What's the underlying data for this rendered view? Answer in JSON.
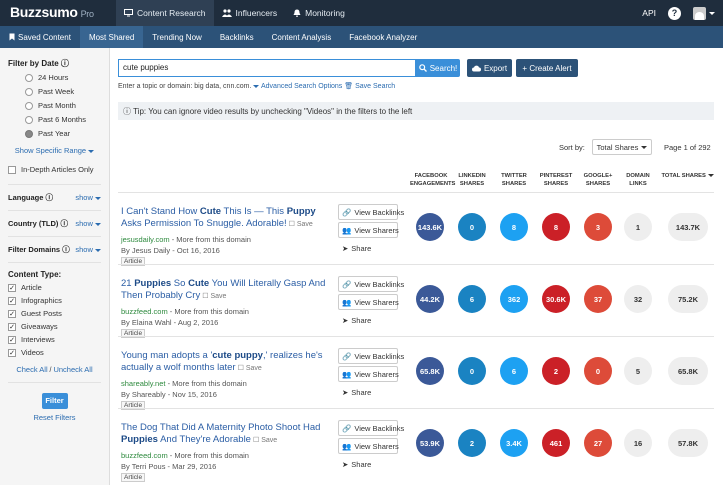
{
  "app": {
    "logo": "Buzzsumo",
    "logo_suffix": "Pro"
  },
  "topnav": {
    "items": [
      {
        "label": "Content Research",
        "icon": "monitor-icon",
        "active": true
      },
      {
        "label": "Influencers",
        "icon": "people-icon",
        "active": false
      },
      {
        "label": "Monitoring",
        "icon": "bell-icon",
        "active": false
      }
    ],
    "api_label": "API",
    "help_label": "?"
  },
  "subnav": {
    "items": [
      {
        "label": "Saved Content",
        "icon": "bookmark-icon",
        "active": false
      },
      {
        "label": "Most Shared",
        "active": true
      },
      {
        "label": "Trending Now",
        "active": false
      },
      {
        "label": "Backlinks",
        "active": false
      },
      {
        "label": "Content Analysis",
        "active": false
      },
      {
        "label": "Facebook Analyzer",
        "active": false
      }
    ]
  },
  "sidebar": {
    "filter_by_date": "Filter by Date",
    "dates": [
      {
        "label": "24 Hours",
        "selected": false
      },
      {
        "label": "Past Week",
        "selected": false
      },
      {
        "label": "Past Month",
        "selected": false
      },
      {
        "label": "Past 6 Months",
        "selected": false
      },
      {
        "label": "Past Year",
        "selected": true
      }
    ],
    "show_specific_range": "Show Specific Range",
    "in_depth_only": "In-Depth Articles Only",
    "language": "Language",
    "country": "Country (TLD)",
    "filter_domains": "Filter Domains",
    "show_label": "show",
    "content_type": "Content Type:",
    "types": [
      {
        "label": "Article",
        "checked": true
      },
      {
        "label": "Infographics",
        "checked": true
      },
      {
        "label": "Guest Posts",
        "checked": true
      },
      {
        "label": "Giveaways",
        "checked": true
      },
      {
        "label": "Interviews",
        "checked": true
      },
      {
        "label": "Videos",
        "checked": true
      }
    ],
    "check_all": "Check All",
    "separator": " / ",
    "uncheck_all": "Uncheck All",
    "filter_button": "Filter",
    "reset_filters": "Reset Filters"
  },
  "search": {
    "value": "cute puppies",
    "button_label": "Search!",
    "hint_text": "Enter a topic or domain: big data, cnn.com.",
    "advanced_options": "Advanced Search Options",
    "save_search": "Save Search",
    "export_label": "Export",
    "create_alert_label": "+ Create Alert"
  },
  "tip": {
    "text": "Tip: You can ignore video results by unchecking \"Videos\" in the filters to the left"
  },
  "sort": {
    "label": "Sort by:",
    "value": "Total Shares",
    "pages": "Page 1 of 292"
  },
  "columns": [
    {
      "line1": "FACEBOOK",
      "line2": "ENGAGEMENTS"
    },
    {
      "line1": "LINKEDIN",
      "line2": "SHARES"
    },
    {
      "line1": "TWITTER",
      "line2": "SHARES"
    },
    {
      "line1": "PINTEREST",
      "line2": "SHARES"
    },
    {
      "line1": "GOOGLE+",
      "line2": "SHARES"
    },
    {
      "line1": "DOMAIN",
      "line2": "LINKS"
    },
    {
      "line1": "TOTAL SHARES",
      "line2": ""
    }
  ],
  "colors": {
    "facebook": "#3b5998",
    "linkedin": "#1a83c2",
    "twitter": "#1da1f2",
    "pinterest": "#cb2027",
    "googleplus": "#dd4b39",
    "neutral": "#eeeeee"
  },
  "actions": {
    "view_backlinks": "View Backlinks",
    "view_sharers": "View Sharers",
    "share": "Share",
    "save": "Save"
  },
  "articles": [
    {
      "title_parts": [
        {
          "t": "I Can't Stand How ",
          "b": false
        },
        {
          "t": "Cute",
          "b": true
        },
        {
          "t": " This Is — This ",
          "b": false
        },
        {
          "t": "Puppy",
          "b": true
        },
        {
          "t": " Asks Permission To Snuggle. Adorable!",
          "b": false
        }
      ],
      "domain": "jesusdaily.com",
      "more": " - More from this domain",
      "author": "By Jesus Daily - Oct 16, 2016",
      "type": "Article",
      "facebook": "143.6K",
      "linkedin": "0",
      "twitter": "8",
      "pinterest": "8",
      "googleplus": "3",
      "domain_links": "1",
      "total": "143.7K"
    },
    {
      "title_parts": [
        {
          "t": "21 ",
          "b": false
        },
        {
          "t": "Puppies",
          "b": true
        },
        {
          "t": " So ",
          "b": false
        },
        {
          "t": "Cute",
          "b": true
        },
        {
          "t": " You Will Literally Gasp And Then Probably Cry",
          "b": false
        }
      ],
      "domain": "buzzfeed.com",
      "more": " - More from this domain",
      "author": "By Elaina Wahl - Aug 2, 2016",
      "type": "Article",
      "facebook": "44.2K",
      "linkedin": "6",
      "twitter": "362",
      "pinterest": "30.6K",
      "googleplus": "37",
      "domain_links": "32",
      "total": "75.2K"
    },
    {
      "title_parts": [
        {
          "t": "Young man adopts a '",
          "b": false
        },
        {
          "t": "cute puppy",
          "b": true
        },
        {
          "t": ",' realizes he's actually a wolf months later",
          "b": false
        }
      ],
      "domain": "shareably.net",
      "more": " - More from this domain",
      "author": "By Shareably - Nov 15, 2016",
      "type": "Article",
      "facebook": "65.8K",
      "linkedin": "0",
      "twitter": "6",
      "pinterest": "2",
      "googleplus": "0",
      "domain_links": "5",
      "total": "65.8K"
    },
    {
      "title_parts": [
        {
          "t": "The Dog That Did A Maternity Photo Shoot Had ",
          "b": false
        },
        {
          "t": "Puppies",
          "b": true
        },
        {
          "t": " And They're Adorable",
          "b": false
        }
      ],
      "domain": "buzzfeed.com",
      "more": " - More from this domain",
      "author": "By Terri Pous - Mar 29, 2016",
      "type": "Article",
      "facebook": "53.9K",
      "linkedin": "2",
      "twitter": "3.4K",
      "pinterest": "461",
      "googleplus": "27",
      "domain_links": "16",
      "total": "57.8K"
    }
  ]
}
